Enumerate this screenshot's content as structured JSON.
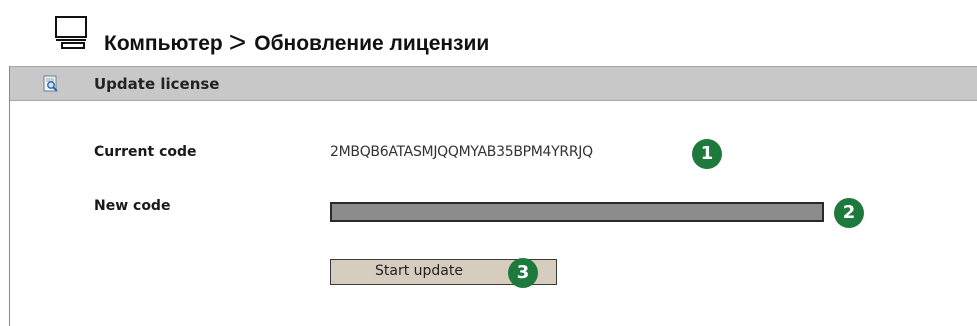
{
  "breadcrumb": {
    "root": "Компьютер",
    "separator": ">",
    "current": "Обновление лицензии"
  },
  "panel": {
    "title": "Update license",
    "icon": "document-search-icon"
  },
  "form": {
    "current_code_label": "Current code",
    "current_code_value": "2MBQB6ATASMJQQMYAB35BPM4YRRJQ",
    "new_code_label": "New code",
    "new_code_value": "",
    "start_button_label": "Start update"
  },
  "callouts": [
    "1",
    "2",
    "3"
  ],
  "colors": {
    "callout": "#1e7a3c",
    "header_bg": "#c8c8c8",
    "input_bg": "#8c8c8c",
    "button_bg": "#d7cdbf"
  }
}
